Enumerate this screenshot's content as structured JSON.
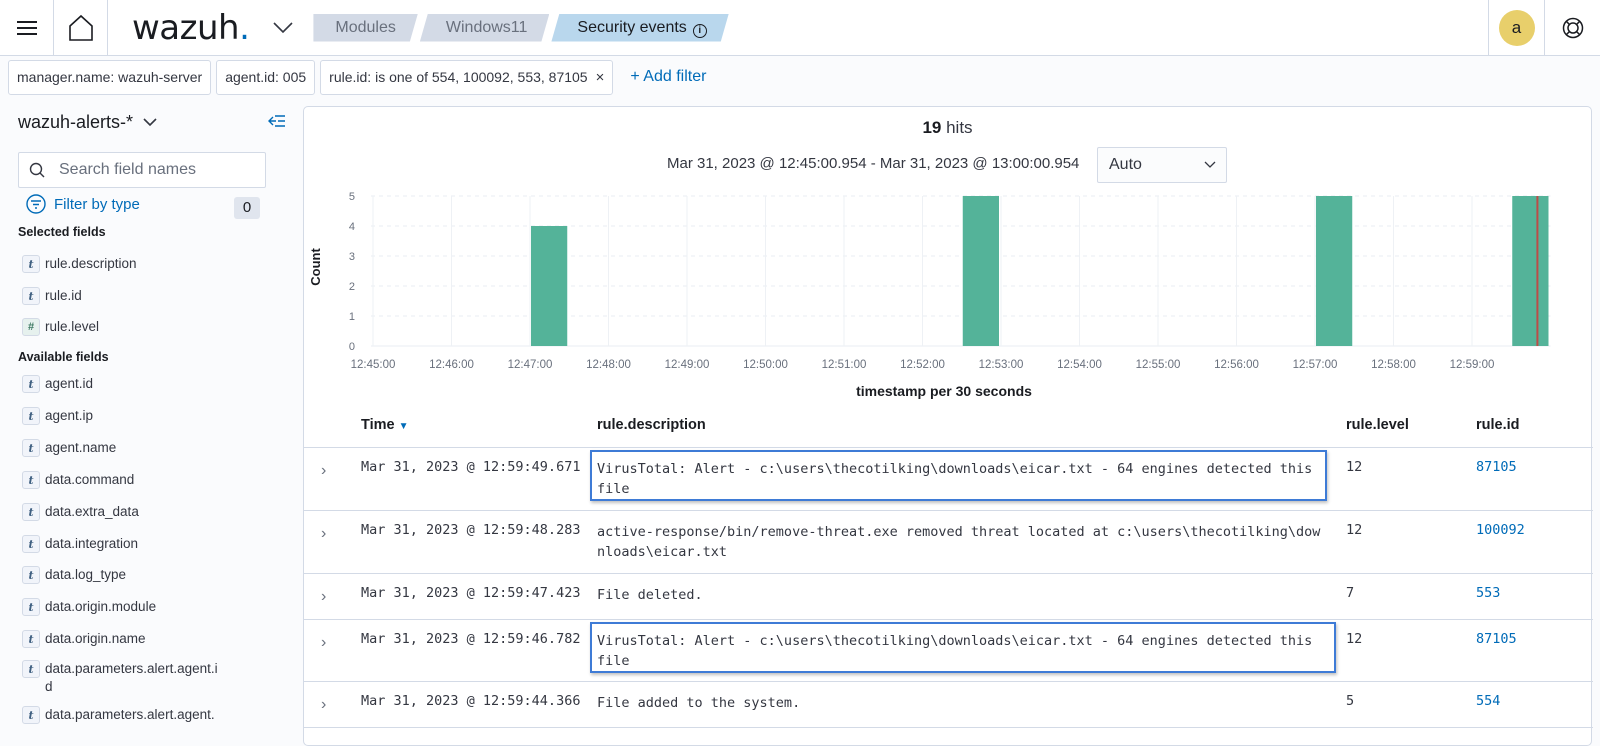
{
  "header": {
    "logo_text": "wazuh",
    "logo_dot": ".",
    "breadcrumbs": [
      {
        "label": "Modules"
      },
      {
        "label": "Windows11"
      },
      {
        "label": "Security events"
      }
    ],
    "info_glyph": "i",
    "avatar_letter": "a"
  },
  "filters": {
    "pills": [
      {
        "label": "manager.name: wazuh-server"
      },
      {
        "label": "agent.id: 005"
      },
      {
        "label": "rule.id: is one of 554, 100092, 553, 87105"
      }
    ],
    "remove_glyph": "×",
    "add_filter_label": "+ Add filter"
  },
  "sidebar": {
    "index_pattern": "wazuh-alerts-*",
    "search_placeholder": "Search field names",
    "filter_by_type_label": "Filter by type",
    "filter_count": "0",
    "selected_title": "Selected fields",
    "selected_fields": [
      {
        "type": "t",
        "name": "rule.description"
      },
      {
        "type": "t",
        "name": "rule.id"
      },
      {
        "type": "#",
        "name": "rule.level"
      }
    ],
    "available_title": "Available fields",
    "available_fields": [
      {
        "type": "t",
        "name": "agent.id"
      },
      {
        "type": "t",
        "name": "agent.ip"
      },
      {
        "type": "t",
        "name": "agent.name"
      },
      {
        "type": "t",
        "name": "data.command"
      },
      {
        "type": "t",
        "name": "data.extra_data"
      },
      {
        "type": "t",
        "name": "data.integration"
      },
      {
        "type": "t",
        "name": "data.log_type"
      },
      {
        "type": "t",
        "name": "data.origin.module"
      },
      {
        "type": "t",
        "name": "data.origin.name"
      },
      {
        "type": "t",
        "name": "data.parameters.alert.agent.id"
      },
      {
        "type": "t",
        "name": "data.parameters.alert.agent."
      }
    ]
  },
  "main": {
    "hits_count": "19",
    "hits_label": " hits",
    "time_range": "Mar 31, 2023 @ 12:45:00.954 - Mar 31, 2023 @ 13:00:00.954",
    "interval_selected": "Auto"
  },
  "chart_data": {
    "type": "bar",
    "title": "",
    "xlabel": "timestamp per 30 seconds",
    "ylabel": "Count",
    "x_ticks": [
      "12:45:00",
      "12:46:00",
      "12:47:00",
      "12:48:00",
      "12:49:00",
      "12:50:00",
      "12:51:00",
      "12:52:00",
      "12:53:00",
      "12:54:00",
      "12:55:00",
      "12:56:00",
      "12:57:00",
      "12:58:00",
      "12:59:00"
    ],
    "y_ticks": [
      0,
      1,
      2,
      3,
      4,
      5
    ],
    "ylim": [
      0,
      5
    ],
    "x_range_seconds": [
      0,
      900
    ],
    "x_range_labels": [
      "12:45:00.954",
      "13:00:00.954"
    ],
    "bucket_seconds": 30,
    "bars": [
      {
        "x": "12:47:00",
        "value": 4
      },
      {
        "x": "12:52:30",
        "value": 5
      },
      {
        "x": "12:57:00",
        "value": 5
      },
      {
        "x": "12:59:30",
        "value": 5
      }
    ],
    "current_time_marker": "12:59:50",
    "grid": true,
    "bar_color": "#54b399",
    "marker_color": "#bd4c48"
  },
  "table": {
    "columns": [
      {
        "label": "Time",
        "sort": "▼"
      },
      {
        "label": "rule.description"
      },
      {
        "label": "rule.level"
      },
      {
        "label": "rule.id"
      }
    ],
    "rows": [
      {
        "time": "Mar 31, 2023 @ 12:59:49.671",
        "description": "VirusTotal: Alert - c:\\users\\thecotilking\\downloads\\eicar.txt - 64 engines detected this file",
        "level": "12",
        "id": "87105",
        "highlighted": true
      },
      {
        "time": "Mar 31, 2023 @ 12:59:48.283",
        "description": "active-response/bin/remove-threat.exe removed threat located at c:\\users\\thecotilking\\downloads\\eicar.txt",
        "level": "12",
        "id": "100092",
        "highlighted": false
      },
      {
        "time": "Mar 31, 2023 @ 12:59:47.423",
        "description": "File deleted.",
        "level": "7",
        "id": "553",
        "highlighted": false
      },
      {
        "time": "Mar 31, 2023 @ 12:59:46.782",
        "description": "VirusTotal: Alert - c:\\users\\thecotilking\\downloads\\eicar.txt - 64 engines detected this file",
        "level": "12",
        "id": "87105",
        "highlighted": true
      },
      {
        "time": "Mar 31, 2023 @ 12:59:44.366",
        "description": "File added to the system.",
        "level": "5",
        "id": "554",
        "highlighted": false
      }
    ]
  }
}
